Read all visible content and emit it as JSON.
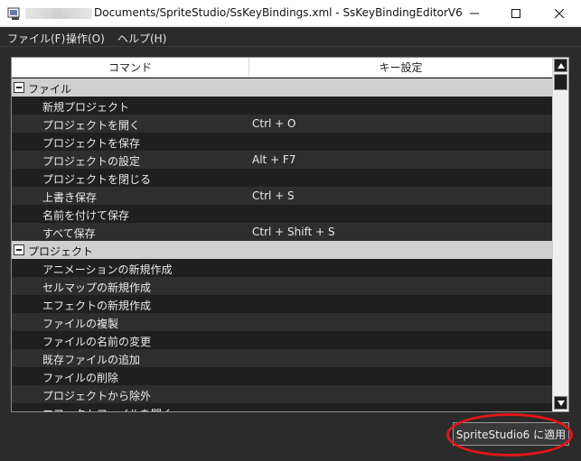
{
  "window": {
    "title": "Documents/SpriteStudio/SsKeyBindings.xml - SsKeyBindingEditorV6"
  },
  "menu": {
    "items": [
      "ファイル(F)",
      "操作(O)",
      "ヘルプ(H)"
    ]
  },
  "table": {
    "headers": [
      "コマンド",
      "キー設定"
    ],
    "rows": [
      {
        "type": "group",
        "command": "ファイル",
        "key": ""
      },
      {
        "type": "item",
        "command": "新規プロジェクト",
        "key": ""
      },
      {
        "type": "item",
        "command": "プロジェクトを開く",
        "key": "Ctrl + O"
      },
      {
        "type": "item",
        "command": "プロジェクトを保存",
        "key": ""
      },
      {
        "type": "item",
        "command": "プロジェクトの設定",
        "key": "Alt + F7"
      },
      {
        "type": "item",
        "command": "プロジェクトを閉じる",
        "key": ""
      },
      {
        "type": "item",
        "command": "上書き保存",
        "key": "Ctrl + S"
      },
      {
        "type": "item",
        "command": "名前を付けて保存",
        "key": ""
      },
      {
        "type": "item",
        "command": "すべて保存",
        "key": "Ctrl + Shift + S"
      },
      {
        "type": "group",
        "command": "プロジェクト",
        "key": ""
      },
      {
        "type": "item",
        "command": "アニメーションの新規作成",
        "key": ""
      },
      {
        "type": "item",
        "command": "セルマップの新規作成",
        "key": ""
      },
      {
        "type": "item",
        "command": "エフェクトの新規作成",
        "key": ""
      },
      {
        "type": "item",
        "command": "ファイルの複製",
        "key": ""
      },
      {
        "type": "item",
        "command": "ファイルの名前の変更",
        "key": ""
      },
      {
        "type": "item",
        "command": "既存ファイルの追加",
        "key": ""
      },
      {
        "type": "item",
        "command": "ファイルの削除",
        "key": ""
      },
      {
        "type": "item",
        "command": "プロジェクトから除外",
        "key": ""
      },
      {
        "type": "item",
        "command": "エフェクトファイルを開く",
        "key": ""
      }
    ]
  },
  "apply_button": {
    "label": "SpriteStudio6 に適用"
  },
  "colors": {
    "highlight_ring": "#e0161a",
    "background": "#2b2b2b"
  },
  "icons": {
    "titlebar": "app-icon",
    "minimize": "minimize-icon",
    "maximize": "maximize-icon",
    "close": "close-icon",
    "group_toggle": "collapse-minus-icon",
    "scroll_up": "arrow-up-icon",
    "scroll_down": "arrow-down-icon"
  }
}
